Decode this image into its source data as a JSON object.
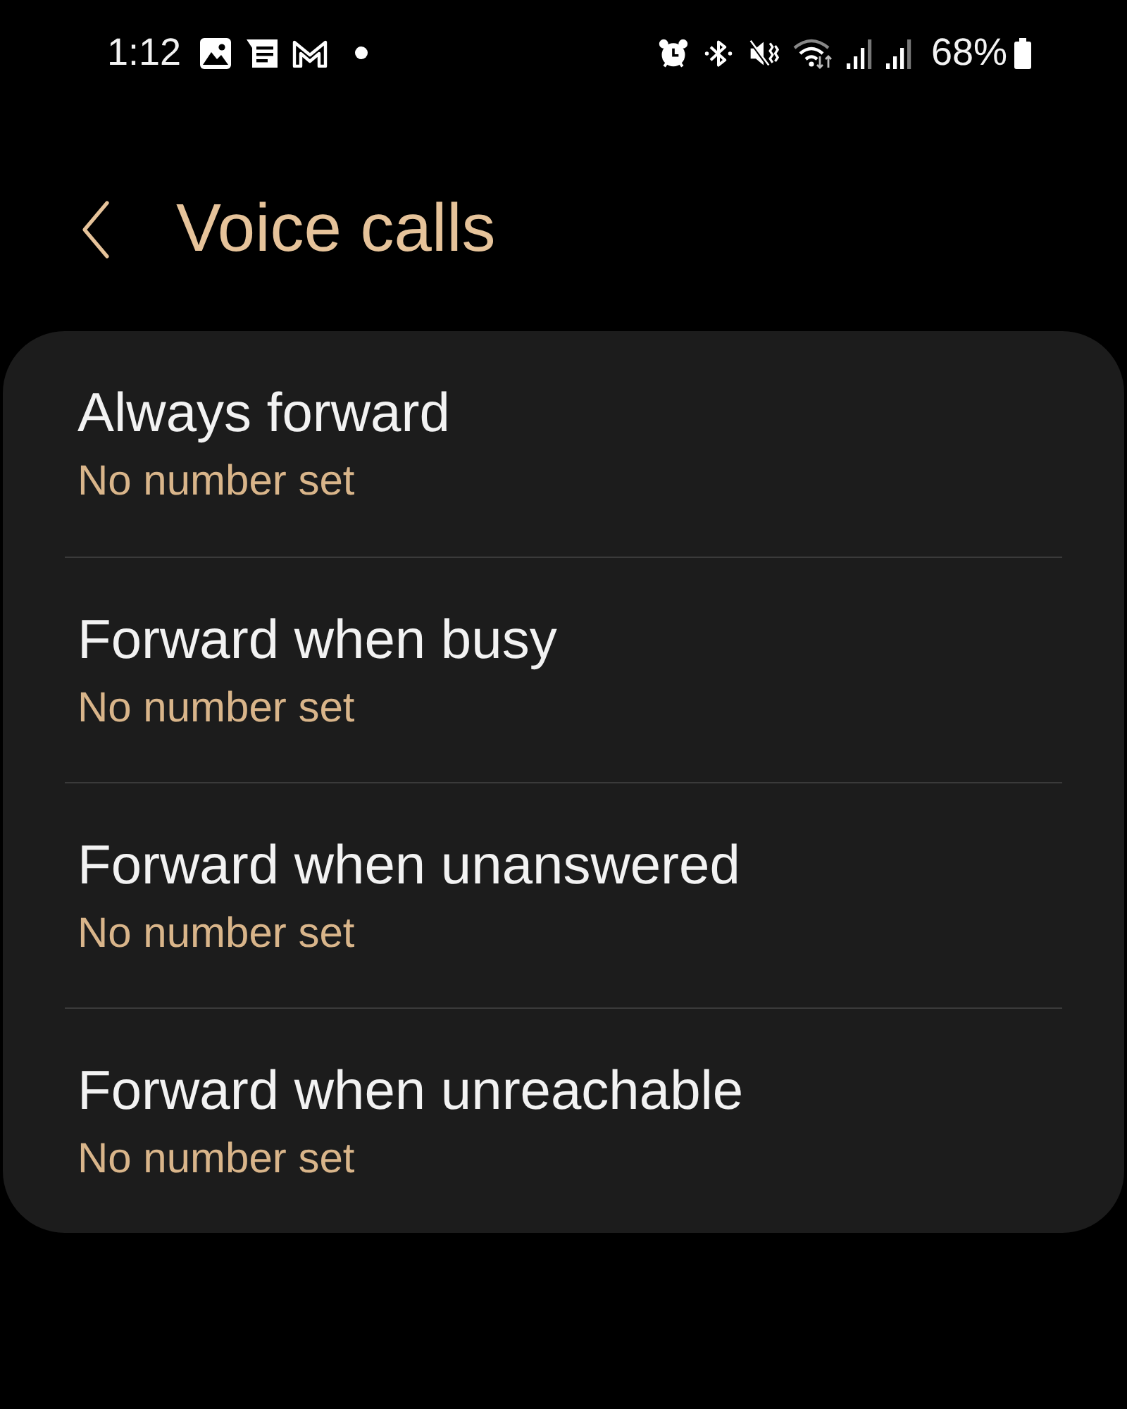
{
  "status_bar": {
    "time": "1:12",
    "battery_text": "68%"
  },
  "header": {
    "title": "Voice calls"
  },
  "options": [
    {
      "title": "Always forward",
      "subtitle": "No number set"
    },
    {
      "title": "Forward when busy",
      "subtitle": "No number set"
    },
    {
      "title": "Forward when unanswered",
      "subtitle": "No number set"
    },
    {
      "title": "Forward when unreachable",
      "subtitle": "No number set"
    }
  ]
}
